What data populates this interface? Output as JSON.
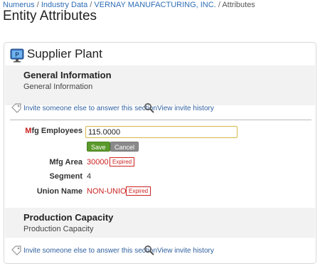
{
  "breadcrumb": {
    "items": [
      "Numerus",
      "Industry Data",
      "VERNAY MANUFACTURING, INC.",
      "Attributes"
    ],
    "separator": "/"
  },
  "page": {
    "title": "Entity Attributes"
  },
  "panel": {
    "icon": "monitor-icon",
    "icon_letter": "P",
    "title": "Supplier Plant"
  },
  "sections": [
    {
      "title": "General Information",
      "subtitle": "General Information",
      "invite_label": "Invite someone else to answer this section",
      "history_label": "View invite history"
    },
    {
      "title": "Production Capacity",
      "subtitle": "Production Capacity",
      "invite_label": "Invite someone else to answer this section",
      "history_label": "View invite history"
    }
  ],
  "fields": {
    "mfg_employees": {
      "label_prefix": "M",
      "label_rest": "fg Employees",
      "value": "115.0000"
    },
    "mfg_area": {
      "label": "Mfg Area",
      "value": "30000",
      "badge": "Expired"
    },
    "segment": {
      "label": "Segment",
      "value": "4"
    },
    "union_name": {
      "label": "Union Name",
      "value": "NON-UNION",
      "badge": "Expired"
    }
  },
  "buttons": {
    "save": "Save",
    "cancel": "Cancel"
  },
  "colors": {
    "link": "#2f6db5",
    "required": "#cc2222",
    "save_button": "#5a9a2a",
    "cancel_button": "#8a8a8a",
    "input_focus_border": "#d6b94a"
  }
}
